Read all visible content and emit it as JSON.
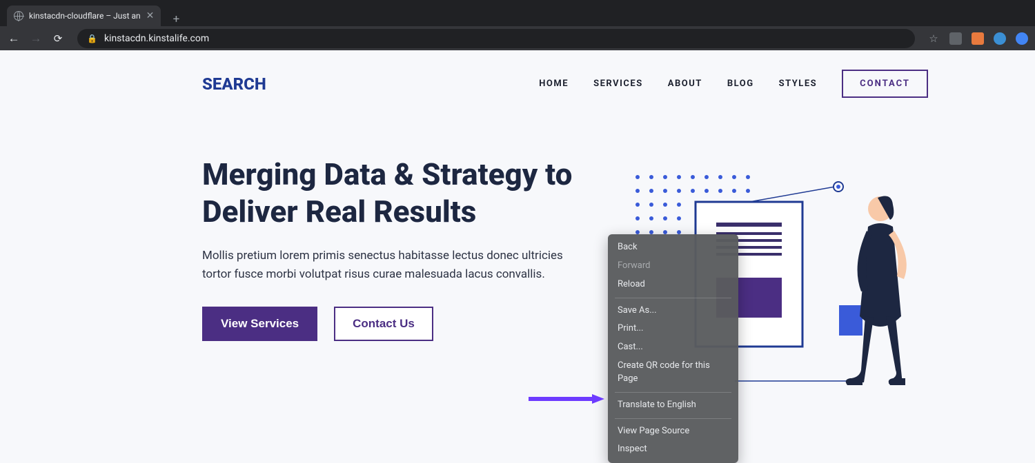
{
  "browser": {
    "tab_title": "kinstacdn-cloudflare – Just an",
    "url": "kinstacdn.kinstalife.com"
  },
  "site": {
    "logo": "SEARCH",
    "nav": [
      "HOME",
      "SERVICES",
      "ABOUT",
      "BLOG",
      "STYLES"
    ],
    "contact": "CONTACT"
  },
  "hero": {
    "title": "Merging Data & Strategy to Deliver Real Results",
    "subtitle": "Mollis pretium lorem primis senectus habitasse lectus donec ultricies tortor fusce morbi volutpat risus curae malesuada lacus convallis.",
    "primary_btn": "View Services",
    "secondary_btn": "Contact Us"
  },
  "context_menu": {
    "back": "Back",
    "forward": "Forward",
    "reload": "Reload",
    "save_as": "Save As...",
    "print": "Print...",
    "cast": "Cast...",
    "qr": "Create QR code for this Page",
    "translate": "Translate to English",
    "source": "View Page Source",
    "inspect": "Inspect"
  }
}
